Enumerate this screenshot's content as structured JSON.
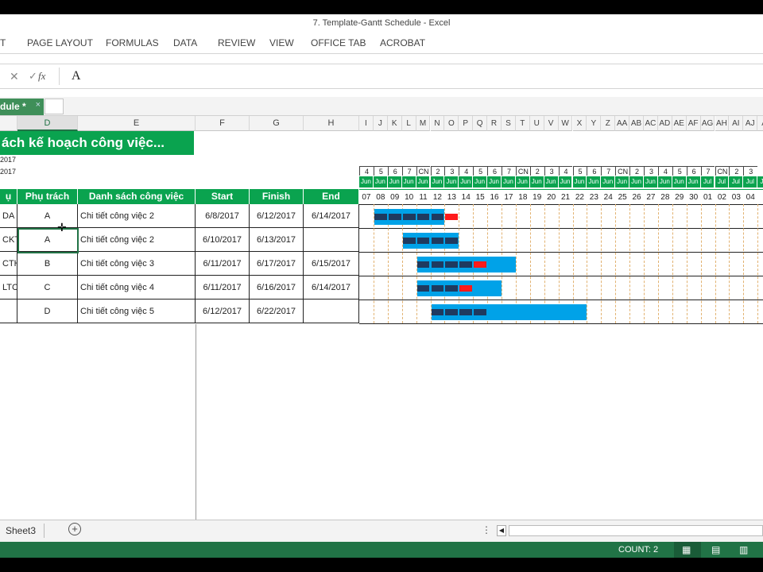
{
  "window": {
    "title": "7. Template-Gantt Schedule - Excel"
  },
  "ribbon": {
    "tabs": [
      "T",
      "PAGE LAYOUT",
      "FORMULAS",
      "DATA",
      "REVIEW",
      "VIEW",
      "OFFICE TAB",
      "ACROBAT"
    ]
  },
  "formula_bar": {
    "cancel_icon": "x-icon",
    "enter_icon": "check-icon",
    "fx_label": "fx",
    "value": "A"
  },
  "doc_tabs": {
    "active": "dule *",
    "close": "×"
  },
  "columns": {
    "left": [
      {
        "label": "",
        "w": 22
      },
      {
        "label": "D",
        "w": 76
      },
      {
        "label": "E",
        "w": 148
      },
      {
        "label": "F",
        "w": 68
      },
      {
        "label": "G",
        "w": 68
      },
      {
        "label": "H",
        "w": 70
      }
    ],
    "timeline": [
      "I",
      "J",
      "K",
      "L",
      "M",
      "N",
      "O",
      "P",
      "Q",
      "R",
      "S",
      "T",
      "U",
      "V",
      "W",
      "X",
      "Y",
      "Z",
      "AA",
      "AB",
      "AC",
      "AD",
      "AE",
      "AF",
      "AG",
      "AH",
      "AI",
      "AJ",
      "A"
    ]
  },
  "sheet": {
    "title": "ách kế hoạch công việc...",
    "date1": "2017",
    "date2": "2017",
    "headers": [
      "ụ",
      "Phụ trách",
      "Danh sách công việc",
      "Start",
      "Finish",
      "End"
    ],
    "rows": [
      {
        "code": "DA",
        "owner": "A",
        "task": "Chi tiết công việc 2",
        "start": "6/8/2017",
        "finish": "6/12/2017",
        "end": "6/14/2017"
      },
      {
        "code": "CKT",
        "owner": "A",
        "task": "Chi tiết công việc 2",
        "start": "6/10/2017",
        "finish": "6/13/2017",
        "end": ""
      },
      {
        "code": "CTH",
        "owner": "B",
        "task": "Chi tiết công việc 3",
        "start": "6/11/2017",
        "finish": "6/17/2017",
        "end": "6/15/2017"
      },
      {
        "code": "LTC",
        "owner": "C",
        "task": "Chi tiết công việc 4",
        "start": "6/11/2017",
        "finish": "6/16/2017",
        "end": "6/14/2017"
      },
      {
        "code": "",
        "owner": "D",
        "task": "Chi tiết công việc 5",
        "start": "6/12/2017",
        "finish": "6/22/2017",
        "end": ""
      }
    ]
  },
  "timeline": {
    "weekdays": [
      "4",
      "5",
      "6",
      "7",
      "CN",
      "2",
      "3",
      "4",
      "5",
      "6",
      "7",
      "CN",
      "2",
      "3",
      "4",
      "5",
      "6",
      "7",
      "CN",
      "2",
      "3",
      "4",
      "5",
      "6",
      "7",
      "CN",
      "2",
      "3"
    ],
    "months": [
      "Jun",
      "Jun",
      "Jun",
      "Jun",
      "Jun",
      "Jun",
      "Jun",
      "Jun",
      "Jun",
      "Jun",
      "Jun",
      "Jun",
      "Jun",
      "Jun",
      "Jun",
      "Jun",
      "Jun",
      "Jun",
      "Jun",
      "Jun",
      "Jun",
      "Jun",
      "Jun",
      "Jun",
      "Jul",
      "Jul",
      "Jul",
      "Jul",
      "Jul"
    ],
    "days": [
      "07",
      "08",
      "09",
      "10",
      "11",
      "12",
      "13",
      "14",
      "15",
      "16",
      "17",
      "18",
      "19",
      "20",
      "21",
      "22",
      "23",
      "24",
      "25",
      "26",
      "27",
      "28",
      "29",
      "30",
      "01",
      "02",
      "03",
      "04"
    ],
    "bars": [
      {
        "start_index": 1,
        "plan_days": 5,
        "done_days": 5,
        "late_days": 1
      },
      {
        "start_index": 3,
        "plan_days": 4,
        "done_days": 4,
        "late_days": 0
      },
      {
        "start_index": 4,
        "plan_days": 7,
        "done_days": 4,
        "late_days": 1
      },
      {
        "start_index": 4,
        "plan_days": 6,
        "done_days": 3,
        "late_days": 1
      },
      {
        "start_index": 5,
        "plan_days": 11,
        "done_days": 4,
        "late_days": 0
      }
    ],
    "colors": {
      "plan": "#00a2e8",
      "done": "#1f3a5f",
      "late": "#ff1a1a"
    }
  },
  "sheet_tabs": {
    "sheet": "Sheet3",
    "add": "+"
  },
  "status": {
    "count": "COUNT: 2"
  }
}
